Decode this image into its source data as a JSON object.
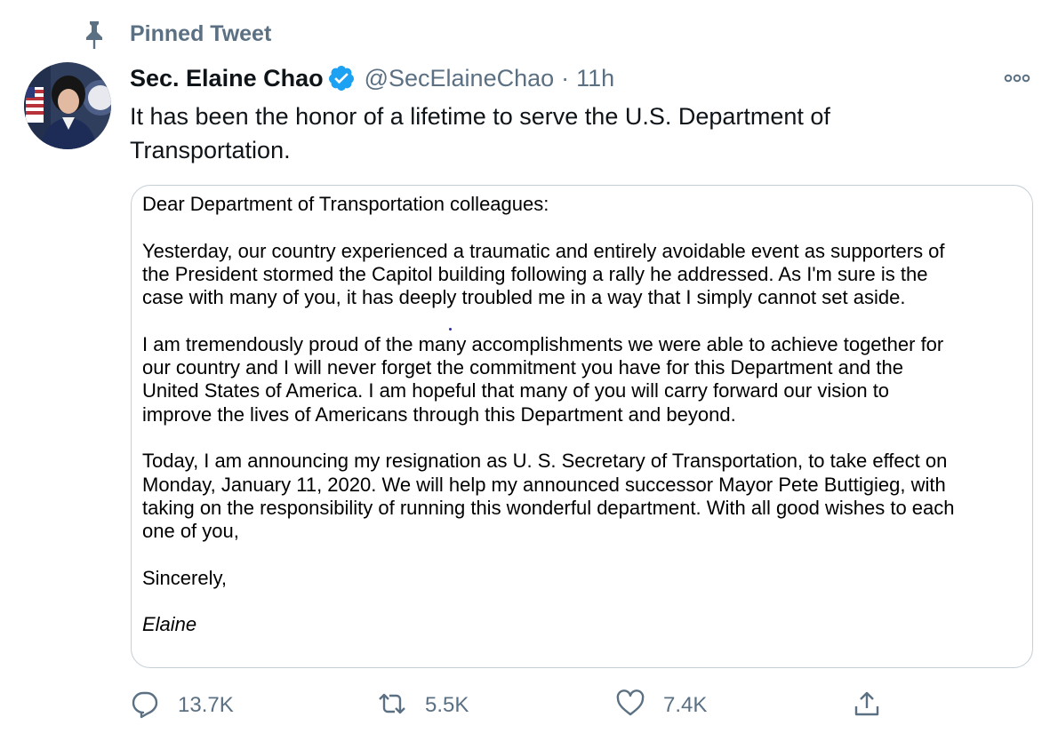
{
  "pinned": {
    "label": "Pinned Tweet",
    "icon": "pin-icon"
  },
  "author": {
    "display_name": "Sec. Elaine Chao",
    "handle": "@SecElaineChao",
    "separator": "·",
    "timestamp": "11h",
    "verified": true,
    "verified_color": "#1da1f2"
  },
  "tweet": {
    "text_lines": [
      "It has been the honor of a lifetime to serve the U.S. Department of",
      "Transportation."
    ]
  },
  "letter": {
    "salutation": "Dear Department of Transportation colleagues:",
    "p1": [
      "Yesterday, our country experienced a traumatic and entirely avoidable event as supporters of",
      "the President stormed the Capitol building following a rally he addressed.  As I'm sure is the",
      "case with many of you, it has deeply troubled me in a way that I simply cannot set aside."
    ],
    "p2": [
      "I am tremendously proud of the many accomplishments we were able to achieve together for",
      "our country and I will never forget the commitment you have for this Department and the",
      "United States of America.  I am hopeful that many of you will carry forward our vision to",
      "improve the lives of Americans through this Department and beyond."
    ],
    "p3": [
      "Today, I am announcing my resignation as U. S. Secretary of Transportation, to take effect on",
      "Monday, January 11, 2020.   We will help my announced successor Mayor Pete Buttigieg, with",
      "taking on the responsibility of running this wonderful department.  With all good wishes to each",
      "one of you,"
    ],
    "closing": "Sincerely,",
    "signature": "Elaine"
  },
  "actions": {
    "reply_count": "13.7K",
    "retweet_count": "5.5K",
    "like_count": "7.4K",
    "icons": [
      "reply-icon",
      "retweet-icon",
      "like-icon",
      "share-icon"
    ]
  },
  "colors": {
    "secondary_text": "#5b7083",
    "primary_text": "#0f1419",
    "border": "#c4cfd6",
    "verified": "#1da1f2"
  }
}
